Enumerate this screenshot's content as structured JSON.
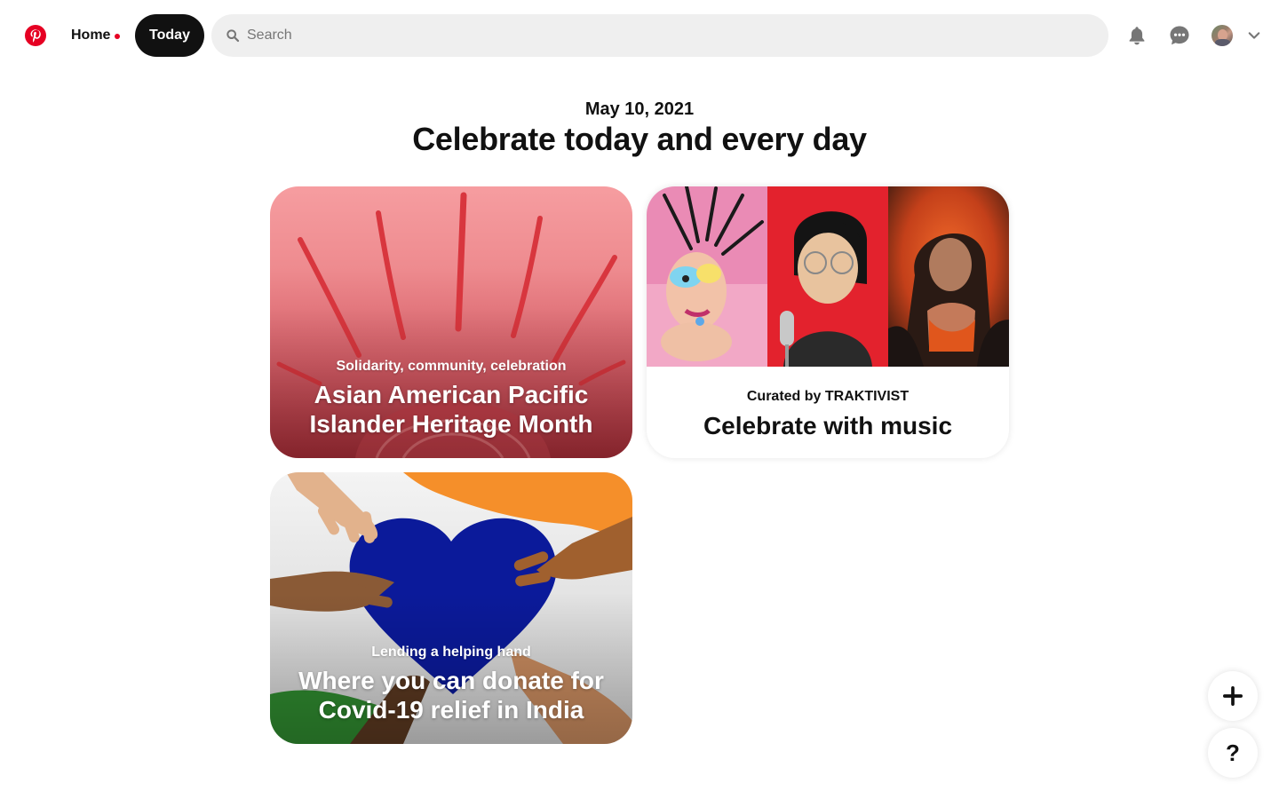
{
  "brand": {
    "name": "Pinterest",
    "logo_icon": "pinterest-logo-icon",
    "color": "#e60023"
  },
  "nav": {
    "home_label": "Home",
    "today_label": "Today"
  },
  "search": {
    "placeholder": "Search",
    "value": ""
  },
  "header_icons": [
    "bell-icon",
    "chat-bubble-icon",
    "avatar",
    "chevron-down-icon"
  ],
  "page": {
    "date": "May 10, 2021",
    "title": "Celebrate today and every day"
  },
  "cards": [
    {
      "subtitle": "Solidarity, community, celebration",
      "title": "Asian American Pacific Islander Heritage Month"
    },
    {
      "subtitle": "Curated by TRAKTIVIST",
      "title": "Celebrate with music"
    },
    {
      "subtitle": "Lending a helping hand",
      "title": "Where you can donate for Covid-19 relief in India"
    }
  ],
  "fab": {
    "add_icon": "plus-icon",
    "help_label": "?"
  },
  "colors": {
    "accent": "#e60023",
    "dark_pill": "#111111",
    "search_bg": "#efefef"
  }
}
